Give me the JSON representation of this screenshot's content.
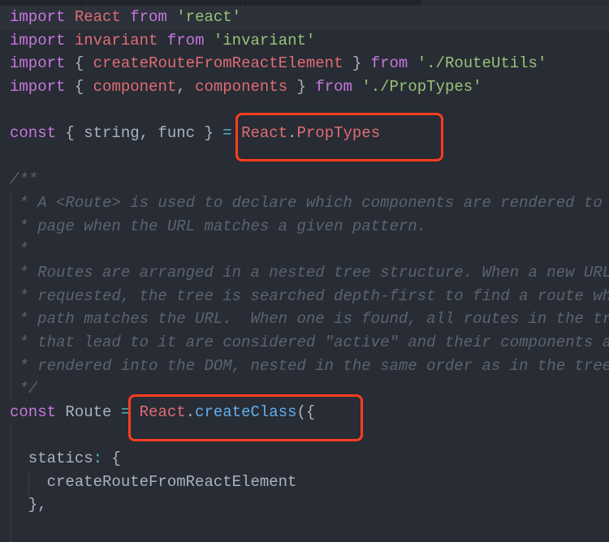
{
  "colors": {
    "background": "#282c34",
    "keyword": "#c678dd",
    "variable": "#e06c75",
    "string": "#98c379",
    "function": "#61afef",
    "operator": "#56b6c2",
    "plain": "#abb2bf",
    "comment": "#5c6370",
    "highlight_box": "#fc3d1f"
  },
  "code_lines": [
    [
      [
        "import",
        "kw"
      ],
      [
        " ",
        "pl"
      ],
      [
        "React",
        "var"
      ],
      [
        " ",
        "pl"
      ],
      [
        "from",
        "kw"
      ],
      [
        " ",
        "pl"
      ],
      [
        "'react'",
        "str"
      ]
    ],
    [
      [
        "import",
        "kw"
      ],
      [
        " ",
        "pl"
      ],
      [
        "invariant",
        "var"
      ],
      [
        " ",
        "pl"
      ],
      [
        "from",
        "kw"
      ],
      [
        " ",
        "pl"
      ],
      [
        "'invariant'",
        "str"
      ]
    ],
    [
      [
        "import",
        "kw"
      ],
      [
        " { ",
        "pl"
      ],
      [
        "createRouteFromReactElement",
        "var"
      ],
      [
        " } ",
        "pl"
      ],
      [
        "from",
        "kw"
      ],
      [
        " ",
        "pl"
      ],
      [
        "'./RouteUtils'",
        "str"
      ]
    ],
    [
      [
        "import",
        "kw"
      ],
      [
        " { ",
        "pl"
      ],
      [
        "component",
        "var"
      ],
      [
        ", ",
        "pl"
      ],
      [
        "components",
        "var"
      ],
      [
        " } ",
        "pl"
      ],
      [
        "from",
        "kw"
      ],
      [
        " ",
        "pl"
      ],
      [
        "'./PropTypes'",
        "str"
      ]
    ],
    [],
    [
      [
        "const",
        "kw"
      ],
      [
        " { string, func } ",
        "pl"
      ],
      [
        "=",
        "op"
      ],
      [
        " ",
        "pl"
      ],
      [
        "React",
        "var"
      ],
      [
        ".",
        "pl"
      ],
      [
        "PropTypes",
        "var"
      ]
    ],
    [],
    [
      [
        "/**",
        "cm"
      ]
    ],
    [
      [
        " * A <Route> is used to declare which components are rendered to",
        "cm"
      ]
    ],
    [
      [
        " * page when the URL matches a given pattern.",
        "cm"
      ]
    ],
    [
      [
        " *",
        "cm"
      ]
    ],
    [
      [
        " * Routes are arranged in a nested tree structure. When a new URL",
        "cm"
      ]
    ],
    [
      [
        " * requested, the tree is searched depth-first to find a route wh",
        "cm"
      ]
    ],
    [
      [
        " * path matches the URL.  When one is found, all routes in the tr",
        "cm"
      ]
    ],
    [
      [
        " * that lead to it are considered \"active\" and their components a",
        "cm"
      ]
    ],
    [
      [
        " * rendered into the DOM, nested in the same order as in the tree",
        "cm"
      ]
    ],
    [
      [
        " */",
        "cm"
      ]
    ],
    [
      [
        "const",
        "kw"
      ],
      [
        " Route ",
        "pl"
      ],
      [
        "=",
        "op"
      ],
      [
        " ",
        "pl"
      ],
      [
        "React",
        "var"
      ],
      [
        ".",
        "pl"
      ],
      [
        "createClass",
        "fn"
      ],
      [
        "({",
        "pl"
      ]
    ],
    [],
    [
      [
        "  statics",
        "pl"
      ],
      [
        ":",
        "op"
      ],
      [
        " {",
        "pl"
      ]
    ],
    [
      [
        "    createRouteFromReactElement",
        "pl"
      ]
    ],
    [
      [
        "  },",
        "pl"
      ]
    ],
    []
  ]
}
